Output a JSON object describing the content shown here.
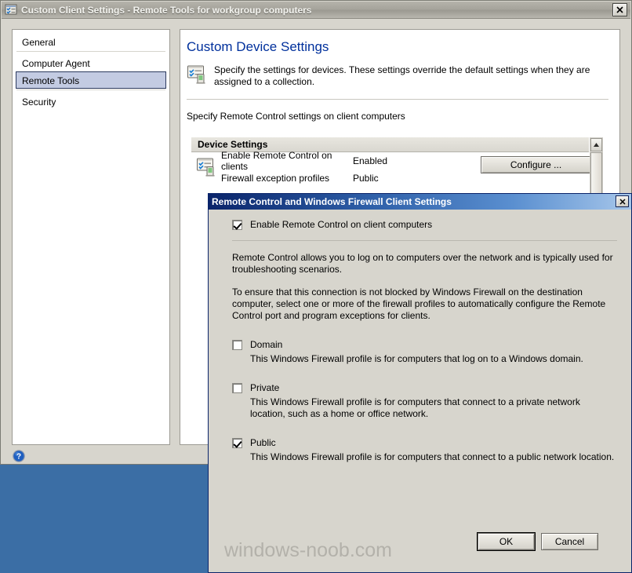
{
  "window": {
    "title": "Custom Client Settings - Remote Tools for workgroup computers",
    "close_label": "✕",
    "icon": "settings-window-icon"
  },
  "sidebar": {
    "items": [
      {
        "label": "General",
        "selected": false
      },
      {
        "label": "Computer Agent",
        "selected": false
      },
      {
        "label": "Remote Tools",
        "selected": true
      },
      {
        "label": "Security",
        "selected": false
      }
    ]
  },
  "content": {
    "page_title": "Custom Device Settings",
    "description": "Specify the settings for devices. These settings override the default settings when they are assigned to a collection.",
    "sub_instruction": "Specify Remote Control settings on client computers",
    "grid": {
      "header": "Device Settings",
      "rows": [
        {
          "label": "Enable Remote Control on clients",
          "value": "Enabled"
        },
        {
          "label": "Firewall exception profiles",
          "value": "Public"
        }
      ],
      "configure_label": "Configure ..."
    },
    "help_label": "?"
  },
  "modal": {
    "title": "Remote Control and Windows Firewall Client Settings",
    "close_label": "✕",
    "enable_checkbox": {
      "label": "Enable Remote Control on client computers",
      "checked": true
    },
    "paragraphs": [
      "Remote Control allows you to log on to computers over the network and is typically used for troubleshooting scenarios.",
      "To ensure that this connection is not blocked by Windows Firewall on the destination computer, select one or more of the firewall profiles to automatically configure the Remote Control port and program exceptions for clients."
    ],
    "profiles": [
      {
        "label": "Domain",
        "checked": false,
        "description": "This Windows Firewall profile is for computers that log on to a Windows domain."
      },
      {
        "label": "Private",
        "checked": false,
        "description": "This Windows Firewall profile is for computers that connect to a private network location, such as a home or office network."
      },
      {
        "label": "Public",
        "checked": true,
        "description": "This Windows Firewall profile is for computers that connect to a public network location."
      }
    ],
    "ok_label": "OK",
    "cancel_label": "Cancel"
  },
  "watermark": "windows-noob.com",
  "colors": {
    "desktop": "#3b6ea5",
    "dialog_face": "#d7d5cd",
    "title_accent": "#00309c",
    "modal_title_start": "#0a246a",
    "selection": "#c3cbe2"
  }
}
